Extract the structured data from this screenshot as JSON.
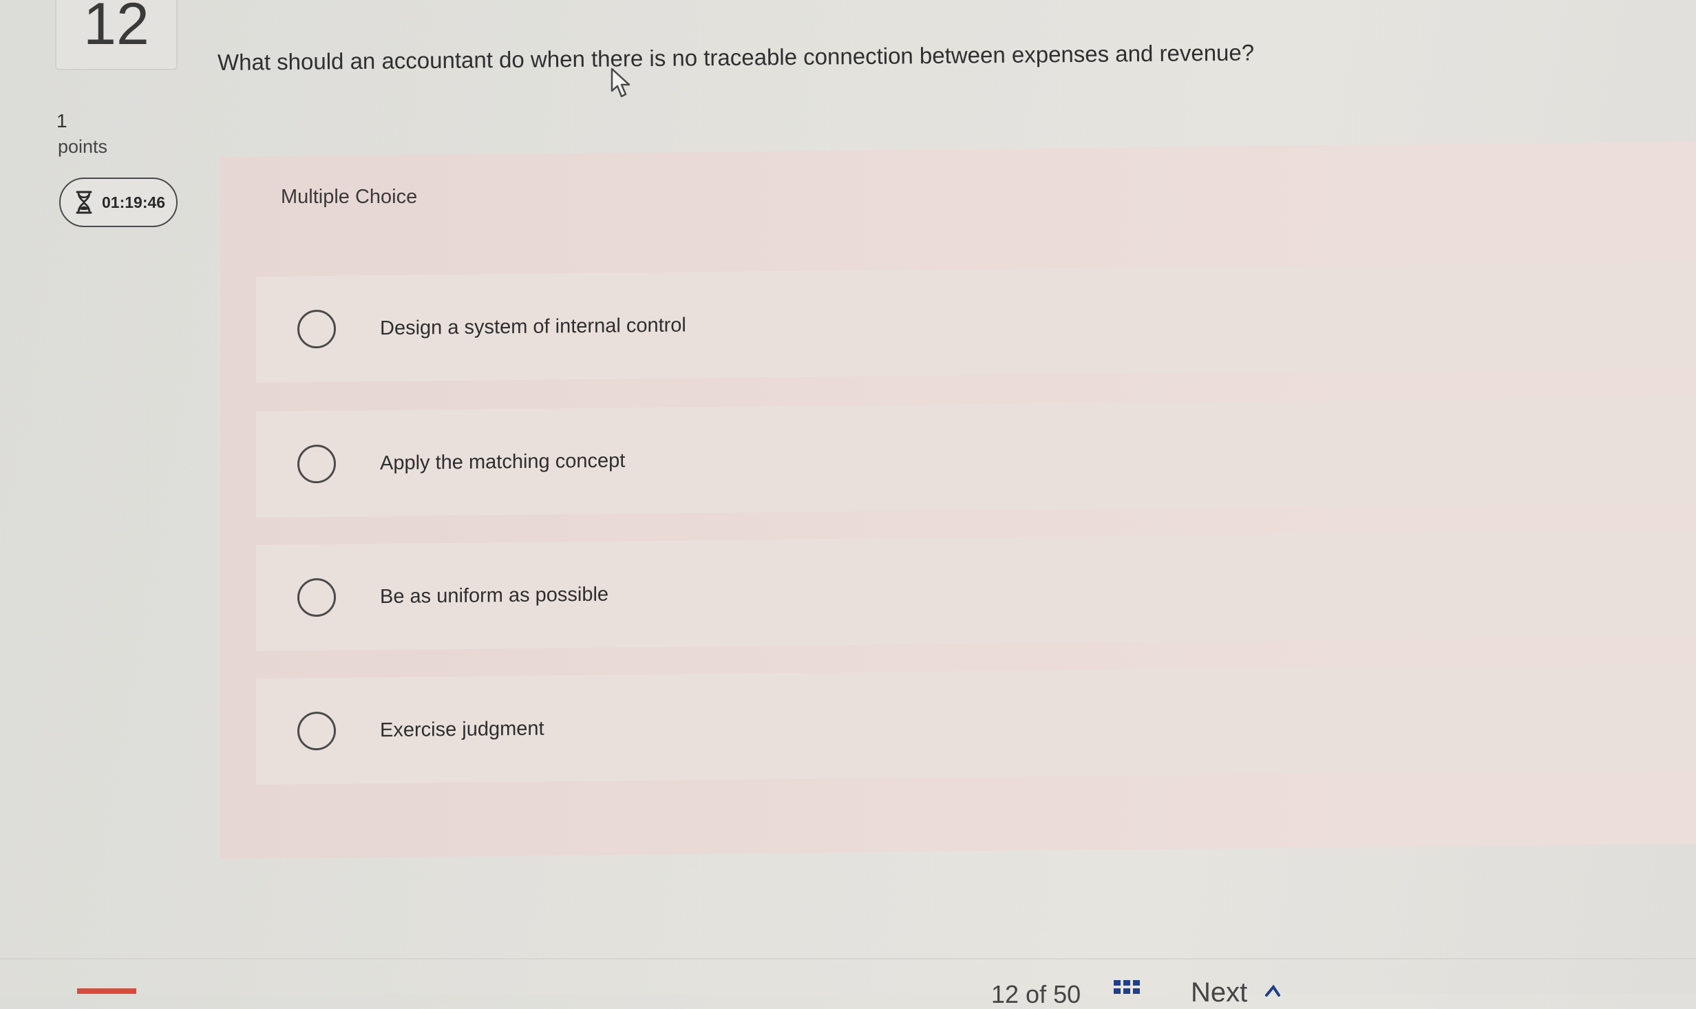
{
  "question_meta": {
    "number": "12",
    "points_value": "1",
    "points_label": "points",
    "timer": "01:19:46"
  },
  "question": {
    "text": "What should an accountant do when there is no traceable connection between expenses and revenue?"
  },
  "choices": {
    "label": "Multiple Choice",
    "options": [
      {
        "text": "Design a system of internal control"
      },
      {
        "text": "Apply the matching concept"
      },
      {
        "text": "Be as uniform as possible"
      },
      {
        "text": "Exercise judgment"
      }
    ]
  },
  "navigation": {
    "page_indicator": "12 of 50",
    "next_label": "Next",
    "grid_icon": "grid-icon"
  },
  "colors": {
    "panel_bg": "#e9dbd7",
    "timer_border": "#4a4a4a",
    "grid_icon": "#1e3f8a",
    "accent_red": "#d94a3a"
  }
}
